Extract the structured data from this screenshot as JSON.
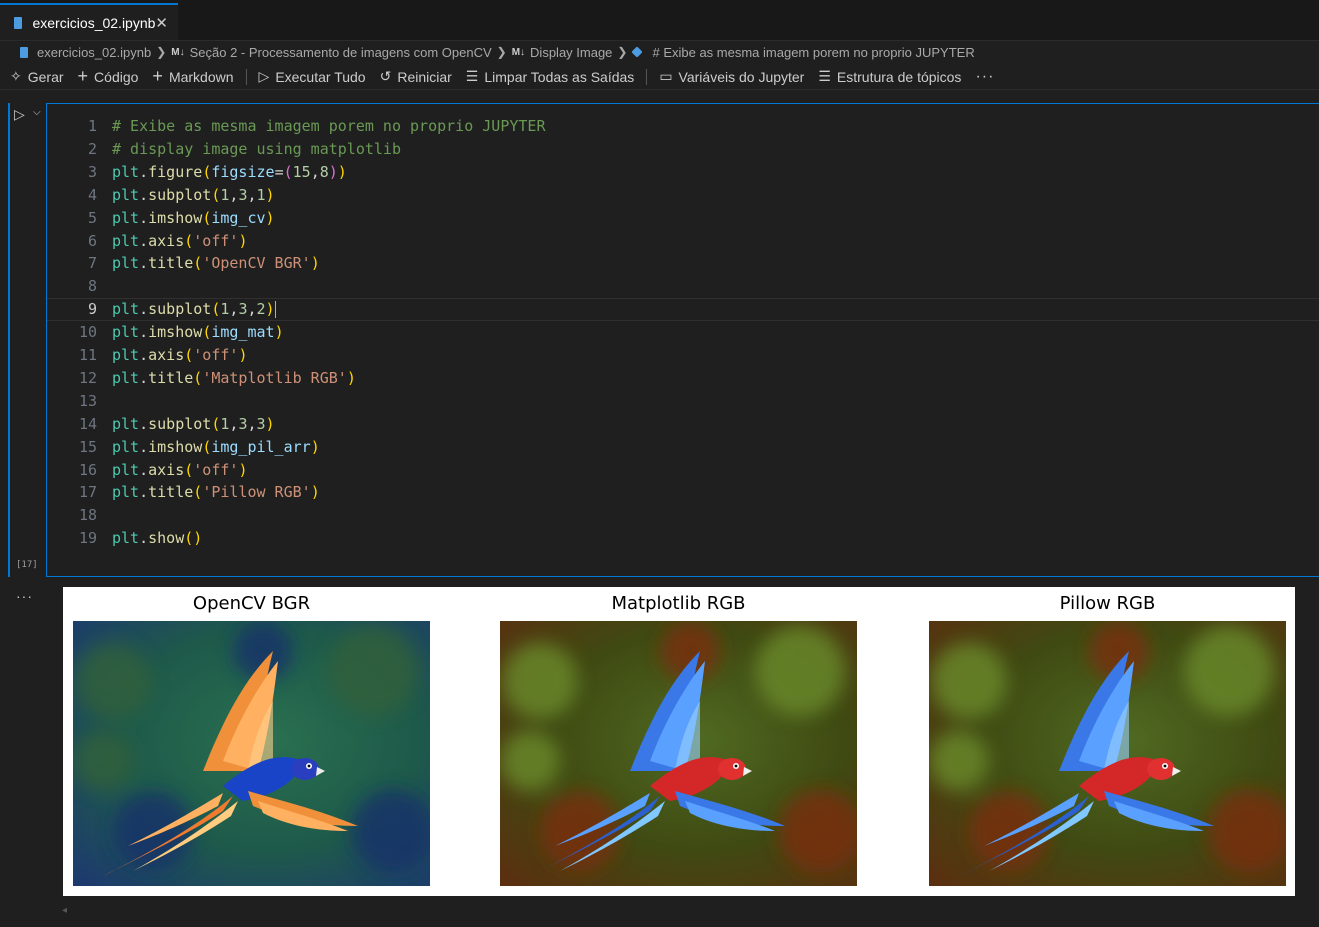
{
  "tab": {
    "filename": "exercicios_02.ipynb",
    "close_icon": "close-icon"
  },
  "breadcrumb": {
    "file": "exercicios_02.ipynb",
    "section1_badge": "M↓",
    "section1": "Seção 2 - Processamento de imagens com OpenCV",
    "section2_badge": "M↓",
    "section2": "Display Image",
    "cell": "# Exibe as mesma imagem porem no proprio JUPYTER"
  },
  "toolbar": {
    "generate": "Gerar",
    "code": "Código",
    "markdown": "Markdown",
    "run_all": "Executar Tudo",
    "restart": "Reiniciar",
    "clear_outputs": "Limpar Todas as Saídas",
    "variables": "Variáveis do Jupyter",
    "outline": "Estrutura de tópicos",
    "more": "···"
  },
  "cell": {
    "execution_count": "[17]",
    "active_line": 9,
    "lines": [
      "# Exibe as mesma imagem porem no proprio JUPYTER",
      "# display image using matplotlib",
      "plt.figure(figsize=(15,8))",
      "plt.subplot(1,3,1)",
      "plt.imshow(img_cv)",
      "plt.axis('off')",
      "plt.title('OpenCV BGR')",
      "",
      "plt.subplot(1,3,2)",
      "plt.imshow(img_mat)",
      "plt.axis('off')",
      "plt.title('Matplotlib RGB')",
      "",
      "plt.subplot(1,3,3)",
      "plt.imshow(img_pil_arr)",
      "plt.axis('off')",
      "plt.title('Pillow RGB')",
      "",
      "plt.show()"
    ]
  },
  "output": {
    "more_icon": "···",
    "plots": [
      {
        "title": "OpenCV BGR",
        "variant": "bgr"
      },
      {
        "title": "Matplotlib RGB",
        "variant": "rgb"
      },
      {
        "title": "Pillow RGB",
        "variant": "rgb"
      }
    ]
  },
  "colors": {
    "accent": "#0078d4",
    "editor_bg": "#1f1f1f",
    "comment": "#6a9955",
    "string": "#ce9178",
    "function": "#dcdcaa",
    "number": "#b5cea8"
  }
}
